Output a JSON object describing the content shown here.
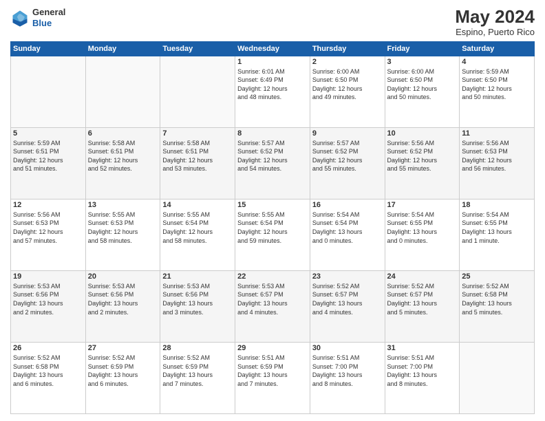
{
  "header": {
    "logo_general": "General",
    "logo_blue": "Blue",
    "month_title": "May 2024",
    "subtitle": "Espino, Puerto Rico"
  },
  "days_of_week": [
    "Sunday",
    "Monday",
    "Tuesday",
    "Wednesday",
    "Thursday",
    "Friday",
    "Saturday"
  ],
  "weeks": [
    [
      {
        "num": "",
        "info": ""
      },
      {
        "num": "",
        "info": ""
      },
      {
        "num": "",
        "info": ""
      },
      {
        "num": "1",
        "info": "Sunrise: 6:01 AM\nSunset: 6:49 PM\nDaylight: 12 hours\nand 48 minutes."
      },
      {
        "num": "2",
        "info": "Sunrise: 6:00 AM\nSunset: 6:50 PM\nDaylight: 12 hours\nand 49 minutes."
      },
      {
        "num": "3",
        "info": "Sunrise: 6:00 AM\nSunset: 6:50 PM\nDaylight: 12 hours\nand 50 minutes."
      },
      {
        "num": "4",
        "info": "Sunrise: 5:59 AM\nSunset: 6:50 PM\nDaylight: 12 hours\nand 50 minutes."
      }
    ],
    [
      {
        "num": "5",
        "info": "Sunrise: 5:59 AM\nSunset: 6:51 PM\nDaylight: 12 hours\nand 51 minutes."
      },
      {
        "num": "6",
        "info": "Sunrise: 5:58 AM\nSunset: 6:51 PM\nDaylight: 12 hours\nand 52 minutes."
      },
      {
        "num": "7",
        "info": "Sunrise: 5:58 AM\nSunset: 6:51 PM\nDaylight: 12 hours\nand 53 minutes."
      },
      {
        "num": "8",
        "info": "Sunrise: 5:57 AM\nSunset: 6:52 PM\nDaylight: 12 hours\nand 54 minutes."
      },
      {
        "num": "9",
        "info": "Sunrise: 5:57 AM\nSunset: 6:52 PM\nDaylight: 12 hours\nand 55 minutes."
      },
      {
        "num": "10",
        "info": "Sunrise: 5:56 AM\nSunset: 6:52 PM\nDaylight: 12 hours\nand 55 minutes."
      },
      {
        "num": "11",
        "info": "Sunrise: 5:56 AM\nSunset: 6:53 PM\nDaylight: 12 hours\nand 56 minutes."
      }
    ],
    [
      {
        "num": "12",
        "info": "Sunrise: 5:56 AM\nSunset: 6:53 PM\nDaylight: 12 hours\nand 57 minutes."
      },
      {
        "num": "13",
        "info": "Sunrise: 5:55 AM\nSunset: 6:53 PM\nDaylight: 12 hours\nand 58 minutes."
      },
      {
        "num": "14",
        "info": "Sunrise: 5:55 AM\nSunset: 6:54 PM\nDaylight: 12 hours\nand 58 minutes."
      },
      {
        "num": "15",
        "info": "Sunrise: 5:55 AM\nSunset: 6:54 PM\nDaylight: 12 hours\nand 59 minutes."
      },
      {
        "num": "16",
        "info": "Sunrise: 5:54 AM\nSunset: 6:54 PM\nDaylight: 13 hours\nand 0 minutes."
      },
      {
        "num": "17",
        "info": "Sunrise: 5:54 AM\nSunset: 6:55 PM\nDaylight: 13 hours\nand 0 minutes."
      },
      {
        "num": "18",
        "info": "Sunrise: 5:54 AM\nSunset: 6:55 PM\nDaylight: 13 hours\nand 1 minute."
      }
    ],
    [
      {
        "num": "19",
        "info": "Sunrise: 5:53 AM\nSunset: 6:56 PM\nDaylight: 13 hours\nand 2 minutes."
      },
      {
        "num": "20",
        "info": "Sunrise: 5:53 AM\nSunset: 6:56 PM\nDaylight: 13 hours\nand 2 minutes."
      },
      {
        "num": "21",
        "info": "Sunrise: 5:53 AM\nSunset: 6:56 PM\nDaylight: 13 hours\nand 3 minutes."
      },
      {
        "num": "22",
        "info": "Sunrise: 5:53 AM\nSunset: 6:57 PM\nDaylight: 13 hours\nand 4 minutes."
      },
      {
        "num": "23",
        "info": "Sunrise: 5:52 AM\nSunset: 6:57 PM\nDaylight: 13 hours\nand 4 minutes."
      },
      {
        "num": "24",
        "info": "Sunrise: 5:52 AM\nSunset: 6:57 PM\nDaylight: 13 hours\nand 5 minutes."
      },
      {
        "num": "25",
        "info": "Sunrise: 5:52 AM\nSunset: 6:58 PM\nDaylight: 13 hours\nand 5 minutes."
      }
    ],
    [
      {
        "num": "26",
        "info": "Sunrise: 5:52 AM\nSunset: 6:58 PM\nDaylight: 13 hours\nand 6 minutes."
      },
      {
        "num": "27",
        "info": "Sunrise: 5:52 AM\nSunset: 6:59 PM\nDaylight: 13 hours\nand 6 minutes."
      },
      {
        "num": "28",
        "info": "Sunrise: 5:52 AM\nSunset: 6:59 PM\nDaylight: 13 hours\nand 7 minutes."
      },
      {
        "num": "29",
        "info": "Sunrise: 5:51 AM\nSunset: 6:59 PM\nDaylight: 13 hours\nand 7 minutes."
      },
      {
        "num": "30",
        "info": "Sunrise: 5:51 AM\nSunset: 7:00 PM\nDaylight: 13 hours\nand 8 minutes."
      },
      {
        "num": "31",
        "info": "Sunrise: 5:51 AM\nSunset: 7:00 PM\nDaylight: 13 hours\nand 8 minutes."
      },
      {
        "num": "",
        "info": ""
      }
    ]
  ]
}
